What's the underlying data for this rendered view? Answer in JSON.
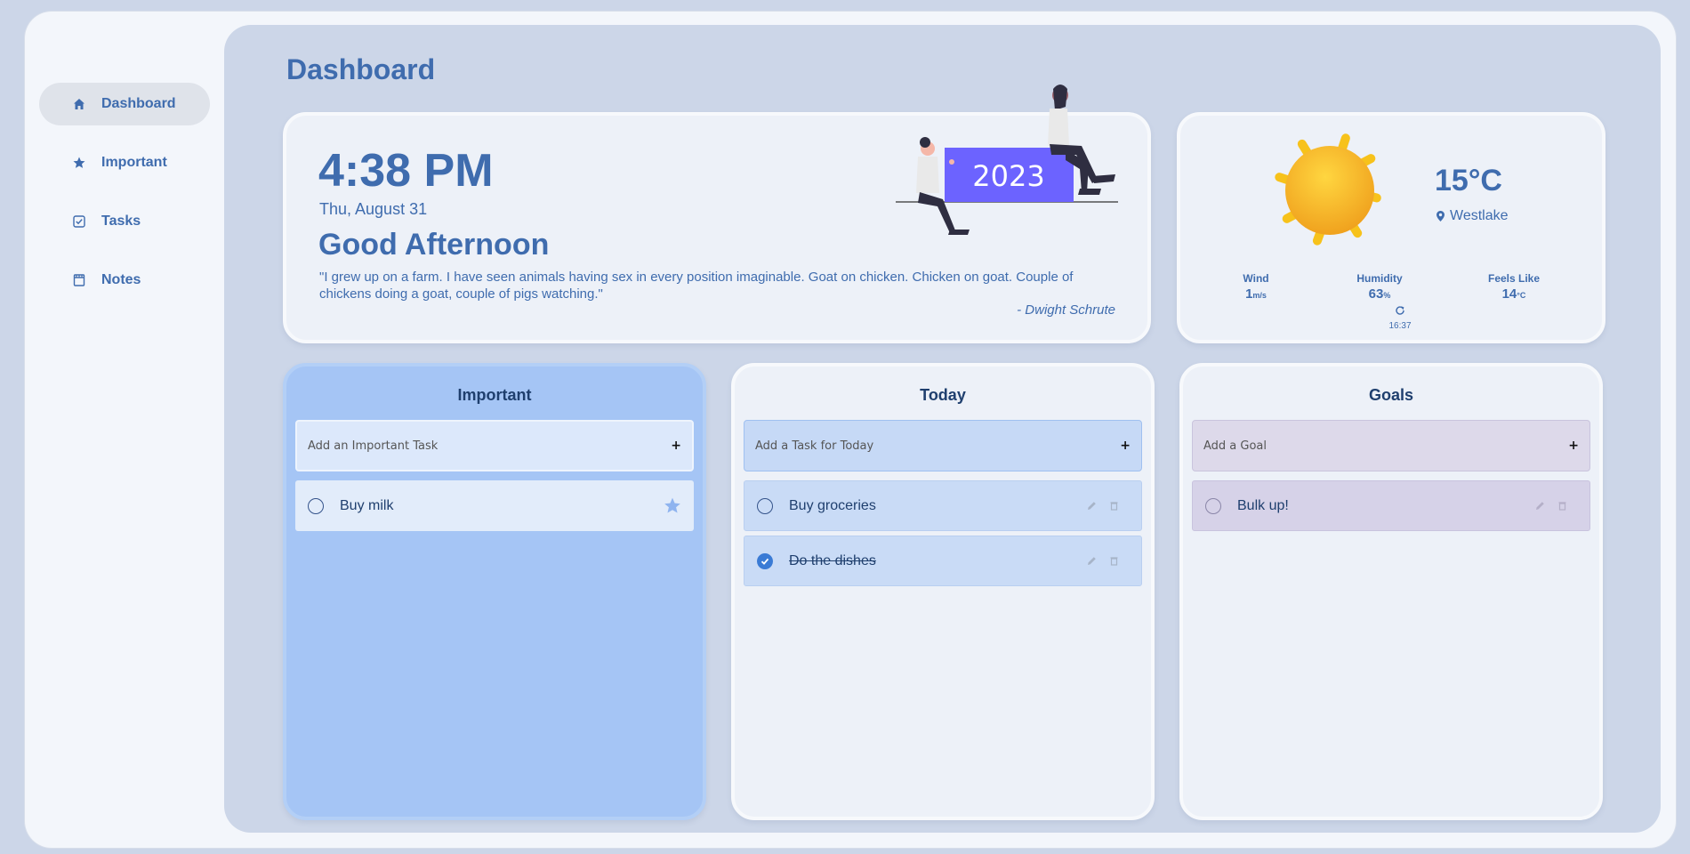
{
  "sidebar": {
    "items": [
      {
        "label": "Dashboard",
        "icon": "home-icon",
        "active": true
      },
      {
        "label": "Important",
        "icon": "star-icon",
        "active": false
      },
      {
        "label": "Tasks",
        "icon": "checkbox-icon",
        "active": false
      },
      {
        "label": "Notes",
        "icon": "notebook-icon",
        "active": false
      }
    ]
  },
  "page": {
    "title": "Dashboard"
  },
  "clock": {
    "time": "4:38 PM",
    "date": "Thu, August 31",
    "greeting": "Good Afternoon",
    "quote": "\"I grew up on a farm. I have seen animals having sex in every position imaginable. Goat on chicken. Chicken on goat. Couple of chickens doing a goat, couple of pigs watching.\"",
    "quote_author": "- Dwight Schrute",
    "illustration_year": "2023"
  },
  "weather": {
    "temperature": "15°C",
    "location": "Westlake",
    "wind_label": "Wind",
    "wind_value": "1",
    "wind_unit": "m/s",
    "humidity_label": "Humidity",
    "humidity_value": "63",
    "humidity_unit": "%",
    "feels_label": "Feels Like",
    "feels_value": "14",
    "feels_unit": "°C",
    "updated_time": "16:37",
    "icon": "sun-icon"
  },
  "lists": {
    "important": {
      "title": "Important",
      "placeholder": "Add an Important Task",
      "add_label": "+",
      "tasks": [
        {
          "text": "Buy milk",
          "done": false
        }
      ]
    },
    "today": {
      "title": "Today",
      "placeholder": "Add a Task for Today",
      "add_label": "+",
      "tasks": [
        {
          "text": "Buy groceries",
          "done": false
        },
        {
          "text": "Do the dishes",
          "done": true
        }
      ]
    },
    "goals": {
      "title": "Goals",
      "placeholder": "Add a Goal",
      "add_label": "+",
      "tasks": [
        {
          "text": "Bulk up!",
          "done": false
        }
      ]
    }
  },
  "colors": {
    "accent": "#3f6cae",
    "background": "#ccd6e8",
    "important_card": "#a5c5f5",
    "checked": "#3a7bd5"
  }
}
